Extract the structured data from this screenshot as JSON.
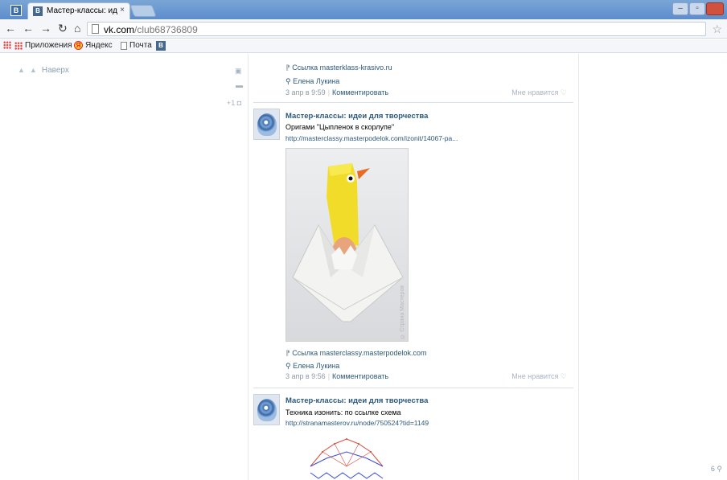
{
  "browser": {
    "tab_title": "Мастер-классы: идеи дл",
    "tab_close": "×",
    "tab_favicon": "В",
    "window_logo": "В",
    "url_host": "vk.com",
    "url_path": "/club68736809",
    "bookmarks": [
      {
        "label": "Приложения",
        "icon": "apps-grid-icon"
      },
      {
        "label": "Яндекс",
        "icon": "yandex-icon"
      },
      {
        "label": "Почта",
        "icon": "page-icon"
      },
      {
        "label": "В",
        "icon": "vk-icon"
      }
    ]
  },
  "sidebar": {
    "up_link": "Наверх",
    "share_count": "+1"
  },
  "feed": {
    "top_fragment": {
      "link_text": "Ссылка masterklass-krasivo.ru",
      "author": "Елена Лукина",
      "date": "3 апр в 9:59",
      "comment": "Комментировать",
      "like": "Мне нравится ♡"
    },
    "posts": [
      {
        "author": "Мастер-классы: идеи для творчества",
        "text": "Оригами \"Цыпленок в скорлупе\"",
        "url": "http://masterclassy.masterpodelok.com/izonit/14067-pa...",
        "watermark": "© Страна Мастеров",
        "link_text": "Ссылка masterclassy.masterpodelok.com",
        "signer": "Елена Лукина",
        "date": "3 апр в 9:56",
        "comment": "Комментировать",
        "like": "Мне нравится ♡"
      },
      {
        "author": "Мастер-классы: идеи для творчества",
        "text": "Техника изонить: по ссылке схема",
        "url": "http://stranamasterov.ru/node/750524?tid=1149"
      }
    ],
    "online_counter": "6"
  }
}
